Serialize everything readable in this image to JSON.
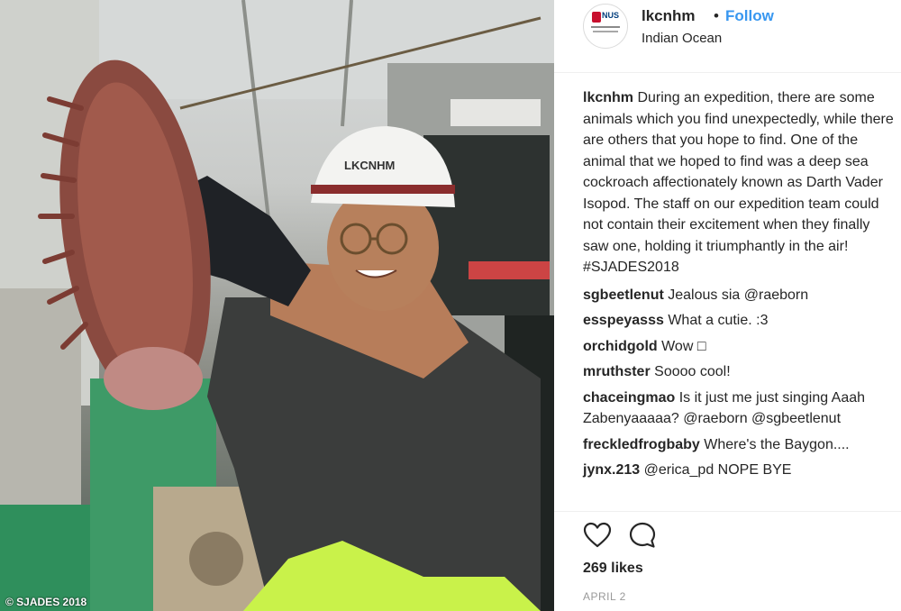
{
  "photo": {
    "credit": "© SJADES 2018",
    "helmet_text": "LKCNHM"
  },
  "header": {
    "username": "lkcnhm",
    "dot": "•",
    "follow_label": "Follow",
    "location": "Indian Ocean"
  },
  "caption": {
    "user": "lkcnhm",
    "text": "During an expedition, there are some animals which you find unexpectedly, while there are others that you hope to find. One of the animal that we hoped to find was a deep sea cockroach affectionately known as Darth Vader Isopod. The staff on our expedition team could not contain their excitement when they finally saw one, holding it triumphantly in the air! #SJADES2018"
  },
  "comments": [
    {
      "user": "sgbeetlenut",
      "text": "Jealous sia @raeborn"
    },
    {
      "user": "esspeyasss",
      "text": "What a cutie. :3"
    },
    {
      "user": "orchidgold",
      "text": "Wow □"
    },
    {
      "user": "mruthster",
      "text": "Soooo cool!"
    },
    {
      "user": "chaceingmao",
      "text": "Is it just me just singing Aaah Zabenyaaaaa? @raeborn @sgbeetlenut"
    },
    {
      "user": "freckledfrogbaby",
      "text": "Where's the Baygon...."
    },
    {
      "user": "jynx.213",
      "text": "@erica_pd NOPE BYE"
    }
  ],
  "actions": {
    "heart_icon": "heart-outline",
    "comment_icon": "speech-bubble-outline"
  },
  "likes": "269 likes",
  "date": "APRIL 2",
  "colors": {
    "follow": "#3897f0",
    "text": "#262626",
    "muted": "#999999"
  }
}
